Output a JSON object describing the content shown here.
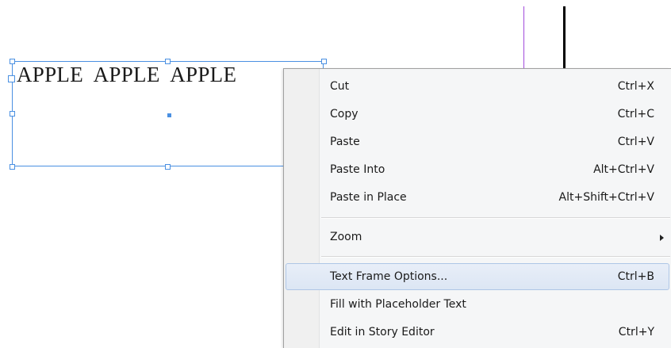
{
  "canvas": {
    "frame_text": "APPLE  APPLE  APPLE"
  },
  "context_menu": {
    "items": [
      {
        "label": "Cut",
        "shortcut": "Ctrl+X"
      },
      {
        "label": "Copy",
        "shortcut": "Ctrl+C"
      },
      {
        "label": "Paste",
        "shortcut": "Ctrl+V"
      },
      {
        "label": "Paste Into",
        "shortcut": "Alt+Ctrl+V"
      },
      {
        "label": "Paste in Place",
        "shortcut": "Alt+Shift+Ctrl+V"
      },
      {
        "label": "Zoom",
        "shortcut": ""
      },
      {
        "label": "Text Frame Options...",
        "shortcut": "Ctrl+B"
      },
      {
        "label": "Fill with Placeholder Text",
        "shortcut": ""
      },
      {
        "label": "Edit in Story Editor",
        "shortcut": "Ctrl+Y"
      }
    ],
    "highlighted_item": "Text Frame Options...",
    "submenu_item": "Zoom"
  },
  "colors": {
    "selection": "#4a90e2",
    "guide_purple": "#a24bdc",
    "guide_black": "#000000",
    "menu_background": "#f5f6f7",
    "menu_highlight": "#dce6f4"
  }
}
